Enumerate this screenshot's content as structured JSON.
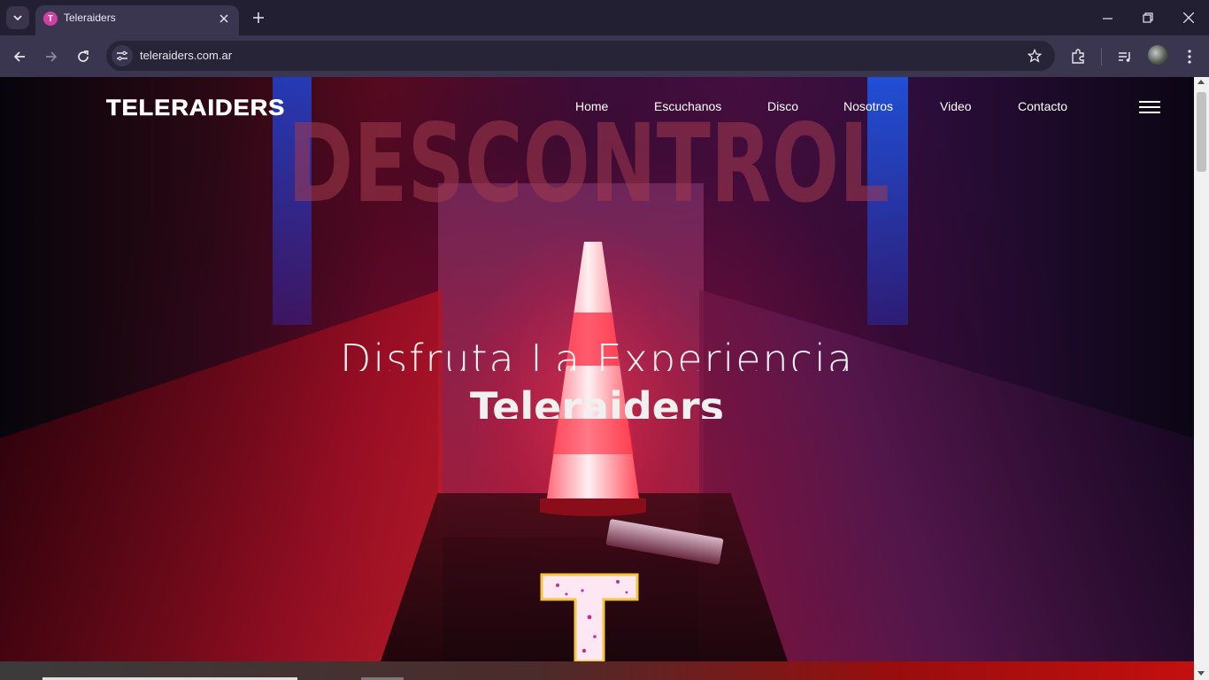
{
  "browser": {
    "tab": {
      "title": "Teleraiders",
      "favicon_letter": "T"
    },
    "address_bar": {
      "url": "teleraiders.com.ar"
    }
  },
  "site": {
    "logo_text": "TELERAIDERS",
    "nav": {
      "home": "Home",
      "escuchanos": "Escuchanos",
      "disco": "Disco",
      "nosotros": "Nosotros",
      "video": "Video",
      "contacto": "Contacto"
    },
    "hero": {
      "line1": "Disfruta La Experiencia",
      "line2": "Teleraiders",
      "background_art_text": "DESCONTROL"
    }
  },
  "colors": {
    "chrome_dark": "#231f33",
    "chrome_toolbar": "#3b3650",
    "favicon": "#d33fa0",
    "hero_red": "#c40f0f"
  },
  "icons": [
    "tab-search-icon",
    "close-icon",
    "plus-icon",
    "minimize-icon",
    "restore-icon",
    "back-arrow-icon",
    "forward-arrow-icon",
    "reload-icon",
    "site-settings-icon",
    "star-icon",
    "extensions-icon",
    "media-controls-icon",
    "kebab-menu-icon",
    "hamburger-icon"
  ]
}
